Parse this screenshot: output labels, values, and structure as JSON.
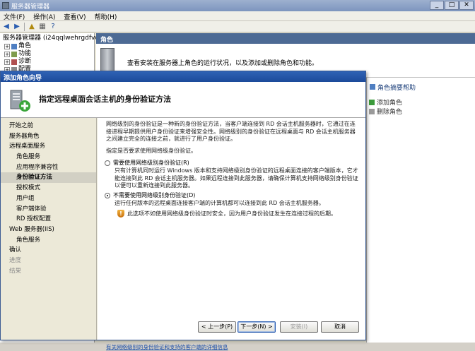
{
  "mmc": {
    "title": "服务器管理器",
    "menu": [
      "文件(F)",
      "操作(A)",
      "查看(V)",
      "帮助(H)"
    ],
    "tree": {
      "root": "服务器管理器 (i24qqlwehrgdfvo)",
      "items": [
        "角色",
        "功能",
        "诊断",
        "配置"
      ]
    },
    "content": {
      "header": "角色",
      "description": "查看安装在服务器上角色的运行状况，以及添加或删除角色和功能。"
    },
    "actions": {
      "header": "角色摘要帮助",
      "items": [
        "添加角色",
        "删除角色"
      ]
    }
  },
  "wizard": {
    "title": "添加角色向导",
    "header_title": "指定远程桌面会话主机的身份验证方法",
    "steps": [
      {
        "label": "开始之前",
        "level": 0,
        "state": "normal"
      },
      {
        "label": "服务器角色",
        "level": 0,
        "state": "normal"
      },
      {
        "label": "远程桌面服务",
        "level": 0,
        "state": "normal"
      },
      {
        "label": "角色服务",
        "level": 1,
        "state": "normal"
      },
      {
        "label": "应用程序兼容性",
        "level": 1,
        "state": "normal"
      },
      {
        "label": "身份验证方法",
        "level": 1,
        "state": "selected"
      },
      {
        "label": "授权模式",
        "level": 1,
        "state": "normal"
      },
      {
        "label": "用户组",
        "level": 1,
        "state": "normal"
      },
      {
        "label": "客户端体验",
        "level": 1,
        "state": "normal"
      },
      {
        "label": "RD 授权配置",
        "level": 1,
        "state": "normal"
      },
      {
        "label": "Web 服务器(IIS)",
        "level": 0,
        "state": "normal"
      },
      {
        "label": "角色服务",
        "level": 1,
        "state": "normal"
      },
      {
        "label": "确认",
        "level": 0,
        "state": "normal"
      },
      {
        "label": "进度",
        "level": 0,
        "state": "disabled"
      },
      {
        "label": "结果",
        "level": 0,
        "state": "disabled"
      }
    ],
    "body": {
      "intro": "网络级别的身份验证是一种新的身份验证方法，当客户端连接到 RD 会话主机服务器时，它通过在连接进程早期提供用户身份验证来增强安全性。网络级别的身份验证在远程桌面与 RD 会话主机服务器之间建立完全的连接之前，就进行了用户身份验证。",
      "question": "指定是否要求使用网络级身份验证。",
      "option1_label": "需要使用网络级别身份验证(R)",
      "option1_desc": "只有计算机同时运行 Windows 版本和支持网络级别身份验证的远程桌面连接的客户端版本，它才能连接到此 RD 会话主机服务器。如果远程连接到此服务器，请确保计算机支持网络级别身份验证以便可以重新连接到此服务器。",
      "option2_label": "不需要使用网络级别身份验证(D)",
      "option2_desc": "运行任何版本的远程桌面连接客户端的计算机都可以连接到此 RD 会话主机服务器。",
      "warning": "此选项不如使用网络级身份验证时安全，因为用户身份验证发生在连接过程的后期。",
      "link": "有关网络级别的身份验证和支持的客户端的详细信息"
    },
    "buttons": {
      "back": "< 上一步(P)",
      "next": "下一步(N) >",
      "install": "安装(I)",
      "cancel": "取消"
    }
  }
}
